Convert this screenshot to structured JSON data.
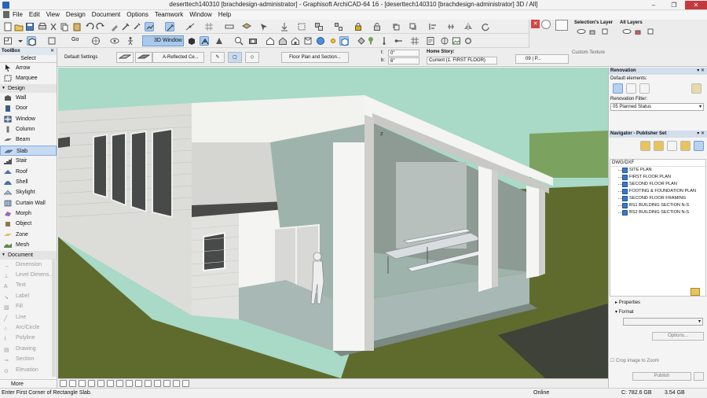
{
  "window": {
    "title": "deserttech140310  [brachdesign-administrator] - Graphisoft ArchiCAD-64 16 - [deserttech140310  [brachdesign-administrator] 3D / All]",
    "controls": [
      "–",
      "❐",
      "✕"
    ]
  },
  "menu": [
    "File",
    "Edit",
    "View",
    "Design",
    "Document",
    "Options",
    "Teamwork",
    "Window",
    "Help"
  ],
  "toolbar": {
    "go_label": "Go",
    "window_3d_label": "3D Window"
  },
  "layers": {
    "selections_layer": "Selection's Layer",
    "all_layers": "All Layers"
  },
  "infobox": {
    "default_settings": "Default Settings",
    "reflected_ceiling": "A-Reflected Ce...",
    "floor_plan_section": "Floor Plan and Section...",
    "t_label": "t:",
    "t_value": "0\"",
    "b_label": "b:",
    "b_value": "6\"",
    "home_story_label": "Home Story:",
    "home_story_value": "Current (1. FIRST FLOOR)",
    "pen_value": "09 | P...",
    "custom_texture": "Custom Texture"
  },
  "toolbox": {
    "title": "ToolBox",
    "select": "Select",
    "select_tools": [
      "Arrow",
      "Marquee"
    ],
    "design_header": "Design",
    "design_tools": [
      "Wall",
      "Door",
      "Window",
      "Column",
      "Beam",
      "Slab",
      "Stair",
      "Roof",
      "Shell",
      "Skylight",
      "Curtain Wall",
      "Morph",
      "Object",
      "Zone",
      "Mesh"
    ],
    "selected_tool": "Slab",
    "document_header": "Document",
    "document_tools": [
      "Dimension",
      "Level Dimens...",
      "Text",
      "Label",
      "Fill",
      "Line",
      "Arc/Circle",
      "Polyline",
      "Drawing",
      "Section",
      "Elevation"
    ],
    "more": "More"
  },
  "renovation": {
    "title": "Renovation",
    "default_elements": "Default elements:",
    "filter_label": "Renovation Filter:",
    "filter_value": "05 Planned Status"
  },
  "navigator": {
    "title": "Navigator - Publisher Set",
    "root": "DWG/DXF",
    "items": [
      "SITE PLAN",
      "FIRST FLOOR PLAN",
      "SECOND FLOOR PLAN",
      "FOOTING & FOUNDATION PLAN",
      "SECOND FLOOR FRAMING",
      "BS1 BUILDING SECTION N-S",
      "BS2 BUILDING SECTION N-S"
    ],
    "properties": "Properties",
    "format": "Format",
    "options": "Options...",
    "crop_to_zoom": "Crop image to Zoom",
    "publish": "Publish"
  },
  "status": {
    "message": "Enter First Corner of Rectangle Slab.",
    "online": "Online",
    "disk": "C: 782.6 GB",
    "memory": "3.54 GB"
  },
  "viewport": {
    "axis_marker": "z",
    "colors": {
      "sky": "#a9d9c7",
      "ground": "#5e6b2d",
      "wall": "#ecece9",
      "shadow_wall": "#bdbdbb",
      "floor": "#a8b8b4",
      "dark": "#3b3b3b",
      "window_glass": "#484a4a"
    }
  }
}
